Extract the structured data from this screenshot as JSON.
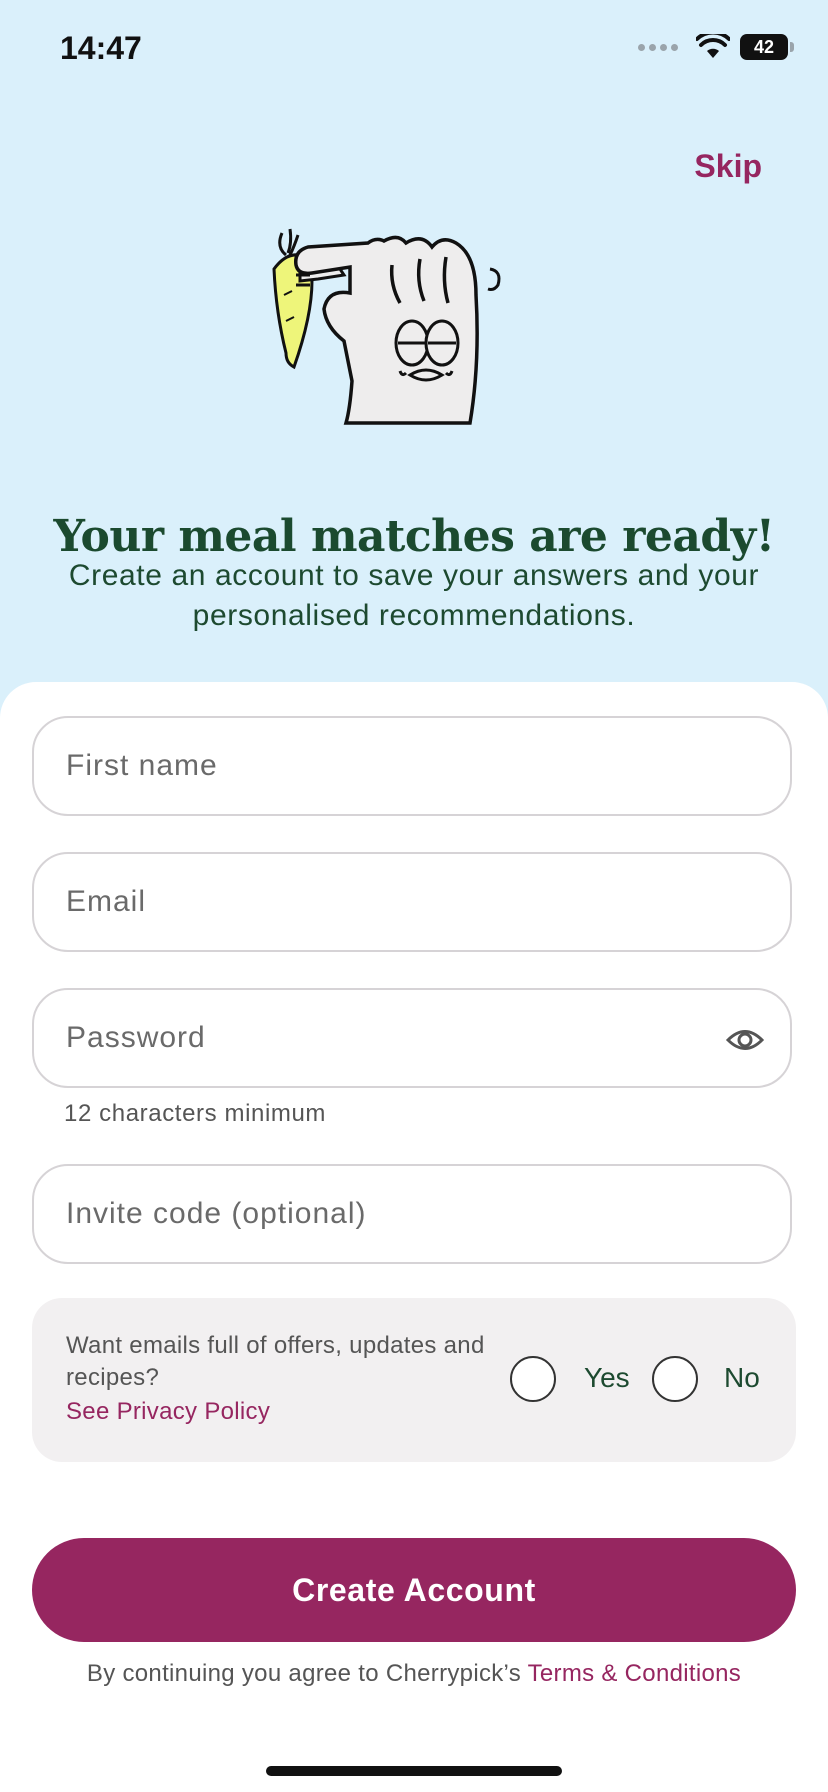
{
  "status": {
    "time": "14:47",
    "battery": "42"
  },
  "header": {
    "skip_label": "Skip"
  },
  "hero": {
    "title": "Your meal matches are ready!",
    "subtitle": "Create an account to save your answers and your personalised recommendations."
  },
  "form": {
    "first_name_placeholder": "First name",
    "email_placeholder": "Email",
    "password_placeholder": "Password",
    "password_hint": "12 characters minimum",
    "invite_placeholder": "Invite code (optional)"
  },
  "consent": {
    "question": "Want emails full of offers, updates and recipes?",
    "privacy_link": "See Privacy Policy",
    "yes_label": "Yes",
    "no_label": "No"
  },
  "cta": {
    "label": "Create Account"
  },
  "terms": {
    "prefix": "By continuing you agree to Cherrypick’s ",
    "link": "Terms & Conditions"
  },
  "colors": {
    "accent": "#962660",
    "heading": "#1b4a2f",
    "background": "#daf0fb"
  }
}
